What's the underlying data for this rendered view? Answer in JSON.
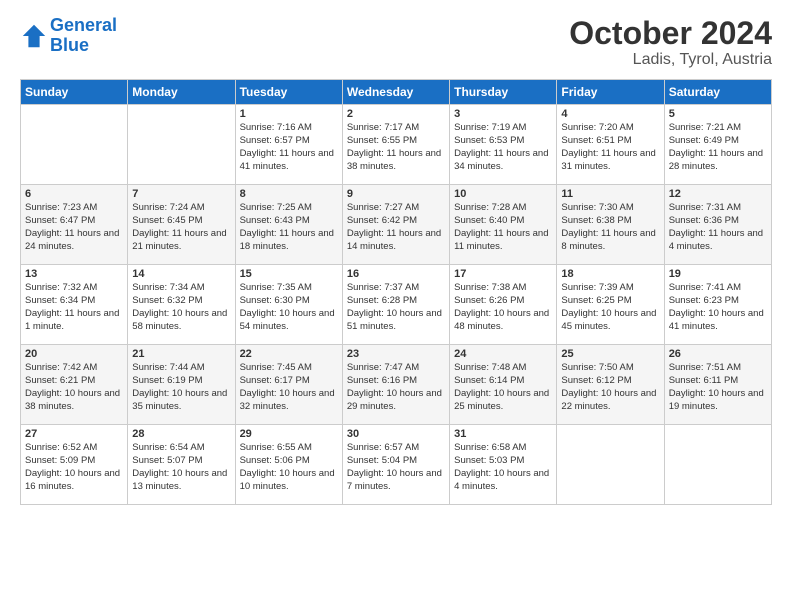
{
  "logo": {
    "line1": "General",
    "line2": "Blue"
  },
  "title": "October 2024",
  "location": "Ladis, Tyrol, Austria",
  "days_of_week": [
    "Sunday",
    "Monday",
    "Tuesday",
    "Wednesday",
    "Thursday",
    "Friday",
    "Saturday"
  ],
  "weeks": [
    [
      {
        "day": "",
        "info": ""
      },
      {
        "day": "",
        "info": ""
      },
      {
        "day": "1",
        "info": "Sunrise: 7:16 AM\nSunset: 6:57 PM\nDaylight: 11 hours and 41 minutes."
      },
      {
        "day": "2",
        "info": "Sunrise: 7:17 AM\nSunset: 6:55 PM\nDaylight: 11 hours and 38 minutes."
      },
      {
        "day": "3",
        "info": "Sunrise: 7:19 AM\nSunset: 6:53 PM\nDaylight: 11 hours and 34 minutes."
      },
      {
        "day": "4",
        "info": "Sunrise: 7:20 AM\nSunset: 6:51 PM\nDaylight: 11 hours and 31 minutes."
      },
      {
        "day": "5",
        "info": "Sunrise: 7:21 AM\nSunset: 6:49 PM\nDaylight: 11 hours and 28 minutes."
      }
    ],
    [
      {
        "day": "6",
        "info": "Sunrise: 7:23 AM\nSunset: 6:47 PM\nDaylight: 11 hours and 24 minutes."
      },
      {
        "day": "7",
        "info": "Sunrise: 7:24 AM\nSunset: 6:45 PM\nDaylight: 11 hours and 21 minutes."
      },
      {
        "day": "8",
        "info": "Sunrise: 7:25 AM\nSunset: 6:43 PM\nDaylight: 11 hours and 18 minutes."
      },
      {
        "day": "9",
        "info": "Sunrise: 7:27 AM\nSunset: 6:42 PM\nDaylight: 11 hours and 14 minutes."
      },
      {
        "day": "10",
        "info": "Sunrise: 7:28 AM\nSunset: 6:40 PM\nDaylight: 11 hours and 11 minutes."
      },
      {
        "day": "11",
        "info": "Sunrise: 7:30 AM\nSunset: 6:38 PM\nDaylight: 11 hours and 8 minutes."
      },
      {
        "day": "12",
        "info": "Sunrise: 7:31 AM\nSunset: 6:36 PM\nDaylight: 11 hours and 4 minutes."
      }
    ],
    [
      {
        "day": "13",
        "info": "Sunrise: 7:32 AM\nSunset: 6:34 PM\nDaylight: 11 hours and 1 minute."
      },
      {
        "day": "14",
        "info": "Sunrise: 7:34 AM\nSunset: 6:32 PM\nDaylight: 10 hours and 58 minutes."
      },
      {
        "day": "15",
        "info": "Sunrise: 7:35 AM\nSunset: 6:30 PM\nDaylight: 10 hours and 54 minutes."
      },
      {
        "day": "16",
        "info": "Sunrise: 7:37 AM\nSunset: 6:28 PM\nDaylight: 10 hours and 51 minutes."
      },
      {
        "day": "17",
        "info": "Sunrise: 7:38 AM\nSunset: 6:26 PM\nDaylight: 10 hours and 48 minutes."
      },
      {
        "day": "18",
        "info": "Sunrise: 7:39 AM\nSunset: 6:25 PM\nDaylight: 10 hours and 45 minutes."
      },
      {
        "day": "19",
        "info": "Sunrise: 7:41 AM\nSunset: 6:23 PM\nDaylight: 10 hours and 41 minutes."
      }
    ],
    [
      {
        "day": "20",
        "info": "Sunrise: 7:42 AM\nSunset: 6:21 PM\nDaylight: 10 hours and 38 minutes."
      },
      {
        "day": "21",
        "info": "Sunrise: 7:44 AM\nSunset: 6:19 PM\nDaylight: 10 hours and 35 minutes."
      },
      {
        "day": "22",
        "info": "Sunrise: 7:45 AM\nSunset: 6:17 PM\nDaylight: 10 hours and 32 minutes."
      },
      {
        "day": "23",
        "info": "Sunrise: 7:47 AM\nSunset: 6:16 PM\nDaylight: 10 hours and 29 minutes."
      },
      {
        "day": "24",
        "info": "Sunrise: 7:48 AM\nSunset: 6:14 PM\nDaylight: 10 hours and 25 minutes."
      },
      {
        "day": "25",
        "info": "Sunrise: 7:50 AM\nSunset: 6:12 PM\nDaylight: 10 hours and 22 minutes."
      },
      {
        "day": "26",
        "info": "Sunrise: 7:51 AM\nSunset: 6:11 PM\nDaylight: 10 hours and 19 minutes."
      }
    ],
    [
      {
        "day": "27",
        "info": "Sunrise: 6:52 AM\nSunset: 5:09 PM\nDaylight: 10 hours and 16 minutes."
      },
      {
        "day": "28",
        "info": "Sunrise: 6:54 AM\nSunset: 5:07 PM\nDaylight: 10 hours and 13 minutes."
      },
      {
        "day": "29",
        "info": "Sunrise: 6:55 AM\nSunset: 5:06 PM\nDaylight: 10 hours and 10 minutes."
      },
      {
        "day": "30",
        "info": "Sunrise: 6:57 AM\nSunset: 5:04 PM\nDaylight: 10 hours and 7 minutes."
      },
      {
        "day": "31",
        "info": "Sunrise: 6:58 AM\nSunset: 5:03 PM\nDaylight: 10 hours and 4 minutes."
      },
      {
        "day": "",
        "info": ""
      },
      {
        "day": "",
        "info": ""
      }
    ]
  ]
}
